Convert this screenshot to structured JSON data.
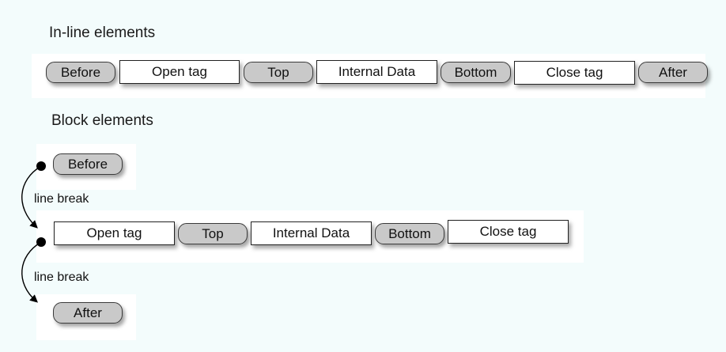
{
  "inline_section": {
    "title": "In-line elements",
    "items": [
      "Before",
      "Open tag",
      "Top",
      "Internal Data",
      "Bottom",
      "Close tag",
      "After"
    ]
  },
  "block_section": {
    "title": "Block elements",
    "before": "Before",
    "row": [
      "Open tag",
      "Top",
      "Internal Data",
      "Bottom",
      "Close tag"
    ],
    "after": "After",
    "line_break_1": "line break",
    "line_break_2": "line break"
  }
}
